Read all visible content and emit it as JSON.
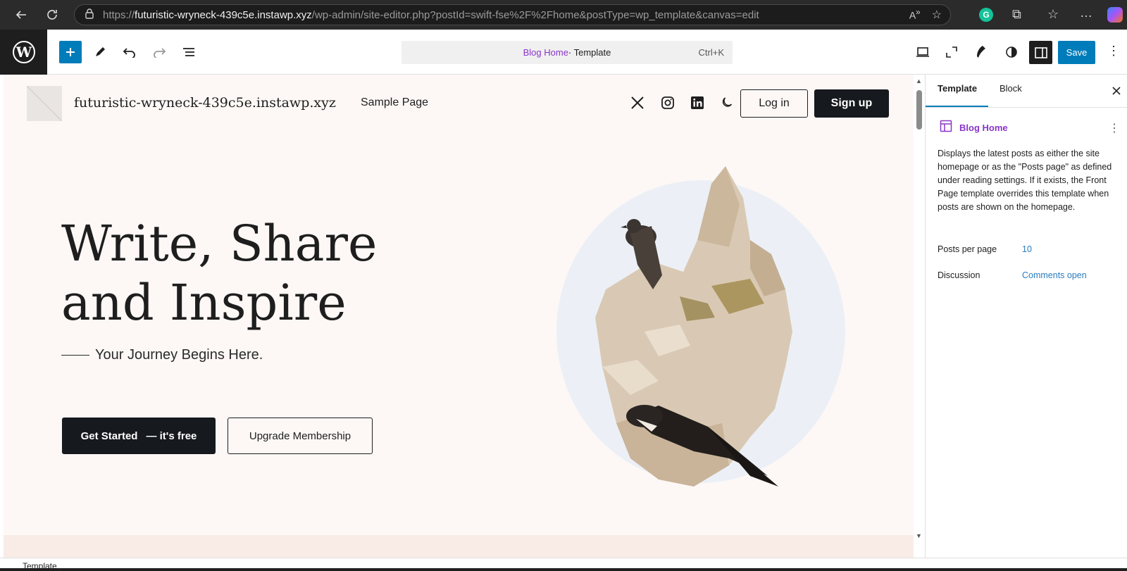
{
  "browser": {
    "url_prefix": "https://",
    "url_host": "futuristic-wryneck-439c5e.instawp.xyz",
    "url_path": "/wp-admin/site-editor.php?postId=swift-fse%2F%2Fhome&postType=wp_template&canvas=edit"
  },
  "toolbar": {
    "command_template_name": "Blog Home",
    "command_separator": " · Template",
    "command_shortcut": "Ctrl+K",
    "save_label": "Save"
  },
  "site": {
    "title": "futuristic-wryneck-439c5e.instawp.xyz",
    "nav": [
      "Sample Page"
    ],
    "login_label": "Log in",
    "signup_label": "Sign up"
  },
  "hero": {
    "title_line1": "Write, Share",
    "title_line2": "and Inspire",
    "subtitle": "Your Journey Begins Here.",
    "cta_primary": "Get Started",
    "cta_primary_suffix": "— it's free",
    "cta_secondary": "Upgrade Membership"
  },
  "sidebar": {
    "tabs": [
      {
        "label": "Template"
      },
      {
        "label": "Block"
      }
    ],
    "template_title": "Blog Home",
    "description": "Displays the latest posts as either the site homepage or as the \"Posts page\" as defined under reading settings. If it exists, the Front Page template overrides this template when posts are shown on the homepage.",
    "properties": [
      {
        "label": "Posts per page",
        "value": "10"
      },
      {
        "label": "Discussion",
        "value": "Comments open"
      }
    ]
  },
  "statusbar": {
    "label": "Template"
  },
  "colors": {
    "accent": "#007cba",
    "template_purple": "#8a35c9",
    "canvas_bg": "#fdf8f6",
    "dark_button": "#16191d"
  }
}
